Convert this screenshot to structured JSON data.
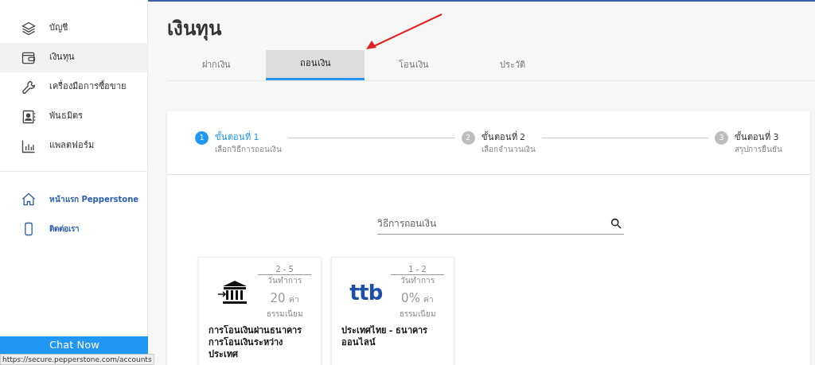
{
  "sidebar": {
    "items": [
      {
        "label": "บัญชี",
        "selected": false
      },
      {
        "label": "เงินทุน",
        "selected": true
      },
      {
        "label": "เครื่องมือการซื้อขาย",
        "selected": false
      },
      {
        "label": "พันธมิตร",
        "selected": false
      },
      {
        "label": "แพลตฟอร์ม",
        "selected": false
      }
    ],
    "links": [
      {
        "label": "หน้าแรก Pepperstone"
      },
      {
        "label": "ติดต่อเรา"
      }
    ],
    "chat_button": "Chat Now"
  },
  "page_title": "เงินทุน",
  "tabs": [
    {
      "label": "ฝากเงิน",
      "selected": false
    },
    {
      "label": "ถอนเงิน",
      "selected": true
    },
    {
      "label": "โอนเงิน",
      "selected": false
    },
    {
      "label": "ประวัติ",
      "selected": false
    }
  ],
  "steps": [
    {
      "number": "1",
      "title": "ขั้นตอนที่ 1",
      "subtitle": "เลือกวิธีการถอนเงิน",
      "selected": true
    },
    {
      "number": "2",
      "title": "ขั้นตอนที่ 2",
      "subtitle": "เลือกจำนวนเงิน",
      "selected": false
    },
    {
      "number": "3",
      "title": "ขั้นตอนที่ 3",
      "subtitle": "สรุปการยืนยัน",
      "selected": false
    }
  ],
  "search": {
    "placeholder": "วิธีการถอนเงิน"
  },
  "methods": [
    {
      "kind": "bank",
      "days": "2 - 5",
      "days_label": "วันทำการ",
      "fee": "20",
      "fee_label_1": "ค่า",
      "fee_label_2": "ธรรมเนียม",
      "name": "การโอนเงินผ่านธนาคาร การโอนเงินระหว่างประเทศ"
    },
    {
      "kind": "logo",
      "logo_text": "ttb",
      "days": "1 - 2",
      "days_label": "วันทำการ",
      "fee": "0%",
      "fee_label_1": "ค่า",
      "fee_label_2": "ธรรมเนียม",
      "name": "ประเทศไทย - ธนาคารออนไลน์"
    }
  ],
  "status_url": "https://secure.pepperstone.com/accounts"
}
